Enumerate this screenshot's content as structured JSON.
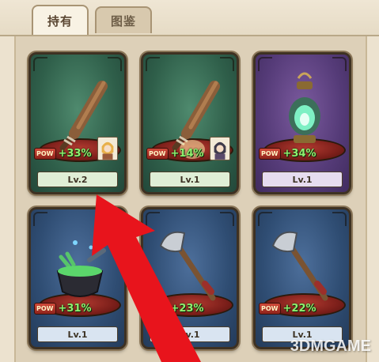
{
  "tabs": [
    {
      "label": "持有",
      "active": true
    },
    {
      "label": "图鉴",
      "active": false
    }
  ],
  "cards": [
    {
      "item": "wooden-club",
      "theme": "green",
      "pow_label": "POW",
      "bonus": "+33%",
      "level": "Lv.2",
      "has_avatar": true
    },
    {
      "item": "wooden-club",
      "theme": "green",
      "pow_label": "POW",
      "bonus": "+14%",
      "level": "Lv.1",
      "has_avatar": true
    },
    {
      "item": "lantern",
      "theme": "purple",
      "pow_label": "POW",
      "bonus": "+34%",
      "level": "Lv.1",
      "has_avatar": false
    },
    {
      "item": "cauldron",
      "theme": "blue",
      "pow_label": "POW",
      "bonus": "+31%",
      "level": "Lv.1",
      "has_avatar": false
    },
    {
      "item": "axe",
      "theme": "blue",
      "pow_label": "POW",
      "bonus": "+23%",
      "level": "Lv.1",
      "has_avatar": false
    },
    {
      "item": "axe",
      "theme": "blue",
      "pow_label": "POW",
      "bonus": "+22%",
      "level": "Lv.1",
      "has_avatar": false
    }
  ],
  "watermark": "3DMGAME",
  "colors": {
    "arrow": "#e8141c",
    "bonus_text": "#8ef06f",
    "tab_active_bg": "#f8f2e4"
  }
}
